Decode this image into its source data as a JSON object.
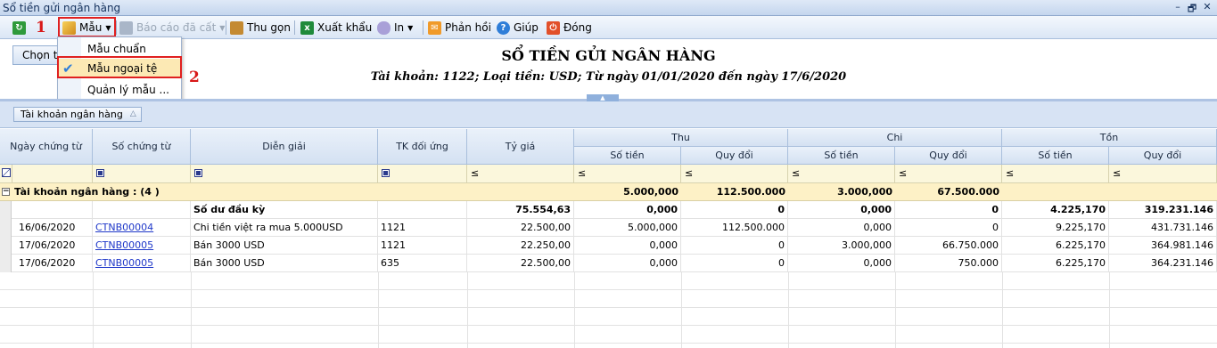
{
  "window": {
    "title": "Sổ tiền gửi ngân hàng",
    "min": "–",
    "restore": "🗗",
    "close": "✕"
  },
  "toolbar": {
    "refresh_icon": "refresh-icon",
    "mau_label": "Mẫu",
    "bao_cao_label": "Báo cáo đã cất",
    "thu_gon_label": "Thu gọn",
    "xuat_khau_label": "Xuất khẩu",
    "in_label": "In",
    "phan_hoi_label": "Phản hồi",
    "giup_label": "Giúp",
    "dong_label": "Đóng"
  },
  "annotations": {
    "step1": "1",
    "step2": "2"
  },
  "menu": {
    "items": [
      "Mẫu chuẩn",
      "Mẫu ngoại tệ",
      "Quản lý mẫu ..."
    ],
    "checked_index": 1
  },
  "report": {
    "title": "SỔ TIỀN GỬI NGÂN HÀNG",
    "subtitle": "Tài khoản: 1122; Loại tiền: USD; Từ ngày 01/01/2020 đến ngày 17/6/2020",
    "chon_button": "Chọn th"
  },
  "groupbar": {
    "chip": "Tài khoản ngân hàng",
    "chip_icon": "sort-asc-icon"
  },
  "columns": {
    "ngay": "Ngày chứng từ",
    "so_ct": "Số chứng từ",
    "dien_giai": "Diễn giải",
    "tk_doi_ung": "TK đối ứng",
    "ty_gia": "Tỷ giá",
    "thu": "Thu",
    "chi": "Chi",
    "ton": "Tồn",
    "so_tien": "Số tiền",
    "quy_doi": "Quy đổi"
  },
  "filter": {
    "le": "≤"
  },
  "group_row": {
    "label": "Tài khoản ngân hàng : (4 )",
    "thu_so_tien": "5.000,000",
    "thu_quy_doi": "112.500.000",
    "chi_so_tien": "3.000,000",
    "chi_quy_doi": "67.500.000"
  },
  "rows": [
    {
      "ngay": "",
      "so_ct": "",
      "dien_giai": "Số dư đầu kỳ",
      "tk": "",
      "ty_gia": "75.554,63",
      "thu_st": "0,000",
      "thu_qd": "0",
      "chi_st": "0,000",
      "chi_qd": "0",
      "ton_st": "4.225,170",
      "ton_qd": "319.231.146"
    },
    {
      "ngay": "16/06/2020",
      "so_ct": "CTNB00004",
      "dien_giai": "Chi tiền việt ra mua 5.000USD",
      "tk": "1121",
      "ty_gia": "22.500,00",
      "thu_st": "5.000,000",
      "thu_qd": "112.500.000",
      "chi_st": "0,000",
      "chi_qd": "0",
      "ton_st": "9.225,170",
      "ton_qd": "431.731.146"
    },
    {
      "ngay": "17/06/2020",
      "so_ct": "CTNB00005",
      "dien_giai": "Bán 3000 USD",
      "tk": "1121",
      "ty_gia": "22.250,00",
      "thu_st": "0,000",
      "thu_qd": "0",
      "chi_st": "3.000,000",
      "chi_qd": "66.750.000",
      "ton_st": "6.225,170",
      "ton_qd": "364.981.146"
    },
    {
      "ngay": "17/06/2020",
      "so_ct": "CTNB00005",
      "dien_giai": "Bán 3000 USD",
      "tk": "635",
      "ty_gia": "22.500,00",
      "thu_st": "0,000",
      "thu_qd": "0",
      "chi_st": "0,000",
      "chi_qd": "750.000",
      "ton_st": "6.225,170",
      "ton_qd": "364.231.146"
    }
  ],
  "colors": {
    "highlight": "#e02020",
    "menu_selected": "#fce9b4",
    "group_row": "#fdf1c6",
    "filter_row": "#fbf7dc"
  }
}
